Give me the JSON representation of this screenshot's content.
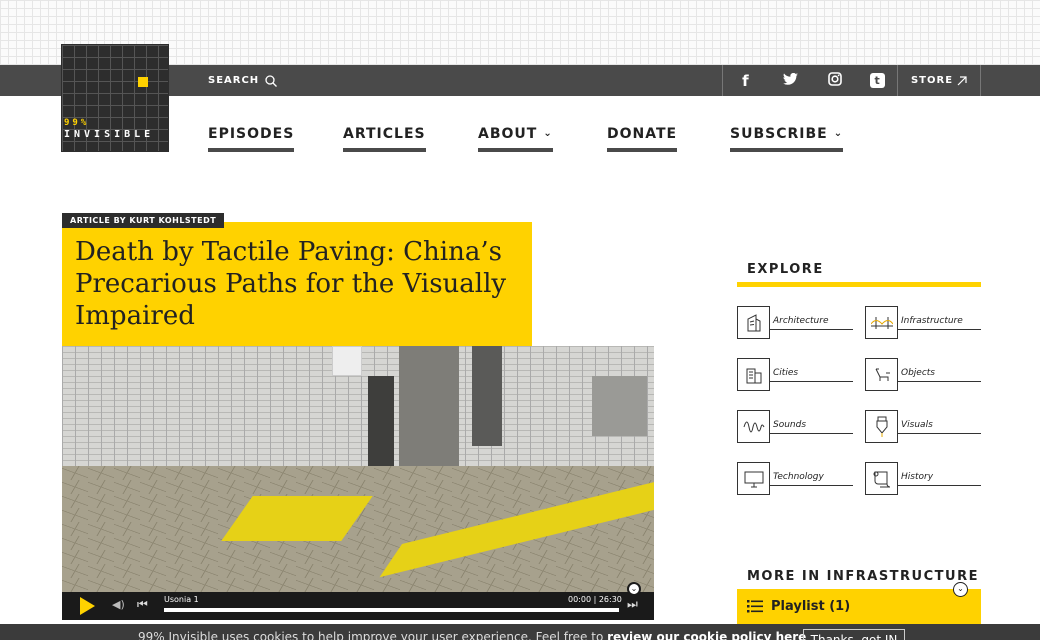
{
  "logo": {
    "number": "99%",
    "word": "INVISIBLE"
  },
  "topbar": {
    "search_label": "SEARCH",
    "social": [
      {
        "icon": "facebook-icon",
        "glyph": "f"
      },
      {
        "icon": "twitter-icon",
        "glyph": "🐦"
      },
      {
        "icon": "instagram-icon",
        "glyph": "◎"
      },
      {
        "icon": "tumblr-icon",
        "glyph": "t"
      }
    ],
    "store_label": "STORE"
  },
  "nav": [
    {
      "label": "EPISODES"
    },
    {
      "label": "ARTICLES"
    },
    {
      "label": "ABOUT"
    },
    {
      "label": "DONATE"
    },
    {
      "label": "SUBSCRIBE"
    }
  ],
  "article": {
    "byline": "ARTICLE BY KURT KOHLSTEDT",
    "title": "Death by Tactile Paving: China’s Precarious Paths for the Visually Impaired"
  },
  "player": {
    "track": "Usonia 1",
    "time": "00:00 | 26:30"
  },
  "sidebar": {
    "explore_heading": "EXPLORE",
    "categories": [
      {
        "label": "Architecture",
        "icon": "architecture-icon"
      },
      {
        "label": "Infrastructure",
        "icon": "bridge-icon"
      },
      {
        "label": "Cities",
        "icon": "cities-icon"
      },
      {
        "label": "Objects",
        "icon": "chair-icon"
      },
      {
        "label": "Sounds",
        "icon": "soundwave-icon"
      },
      {
        "label": "Visuals",
        "icon": "pen-icon"
      },
      {
        "label": "Technology",
        "icon": "monitor-icon"
      },
      {
        "label": "History",
        "icon": "scroll-icon"
      }
    ],
    "more_heading": "MORE IN INFRASTRUCTURE",
    "playlist_label": "Playlist (1)"
  },
  "cookie": {
    "text": "99% Invisible uses cookies to help improve your user experience. Feel free to ",
    "link": "review our cookie policy here",
    "button": "Thanks, got IN"
  },
  "colors": {
    "accent": "#ffd200",
    "bar": "#4a4a4a",
    "dark": "#2d2d2d"
  }
}
